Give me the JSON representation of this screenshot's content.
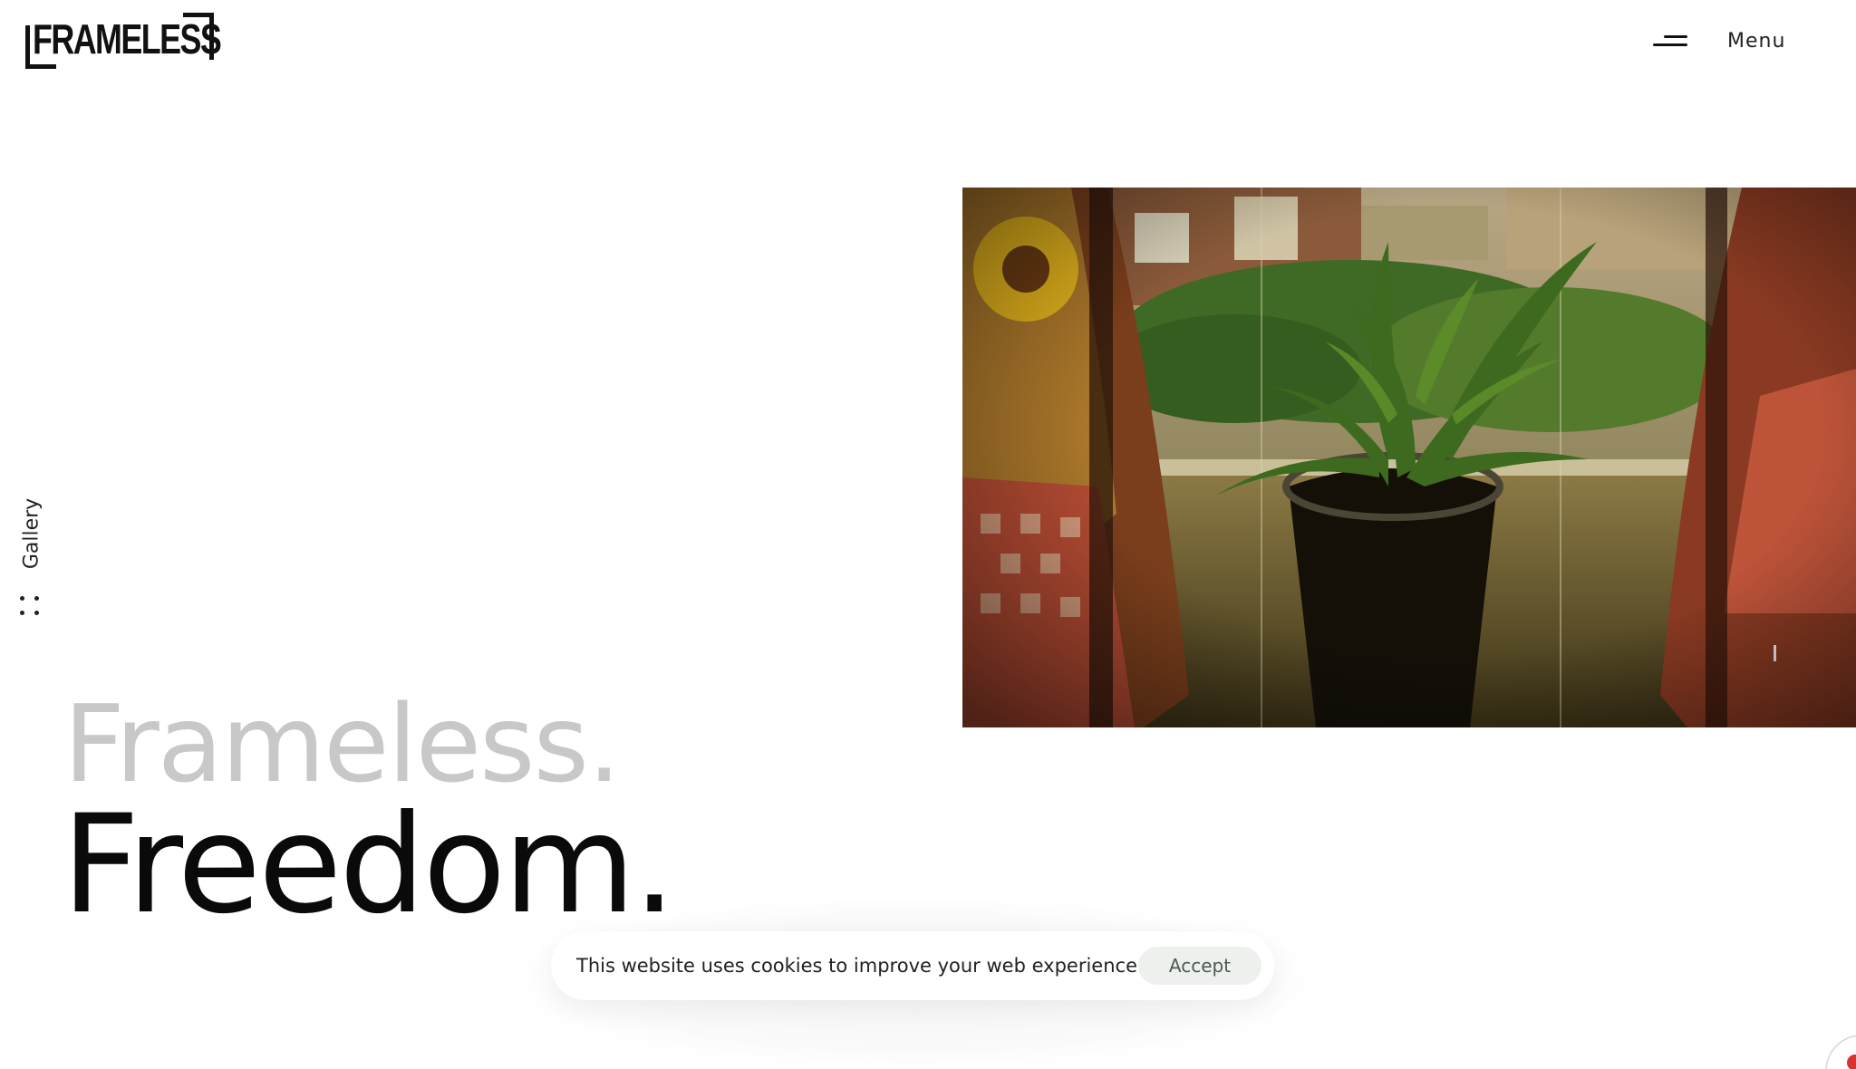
{
  "brand": {
    "logo_text": "FRAMELESS"
  },
  "header": {
    "menu_label": "Menu"
  },
  "side_nav": {
    "gallery_label": "Gallery"
  },
  "hero": {
    "headline_line1": "Frameless.",
    "headline_line2": "Freedom."
  },
  "cookie_banner": {
    "message": "This website uses cookies to improve your web experience.",
    "accept_label": "Accept"
  },
  "colors": {
    "text_primary": "#0a0a0a",
    "text_faded": "#c8c8c8",
    "accept_bg": "#eef0ee",
    "accept_text": "#4b5a50",
    "widget_dot": "#d9342b"
  },
  "icons": {
    "menu": "menu-icon",
    "grid": "grid-dots-icon"
  }
}
